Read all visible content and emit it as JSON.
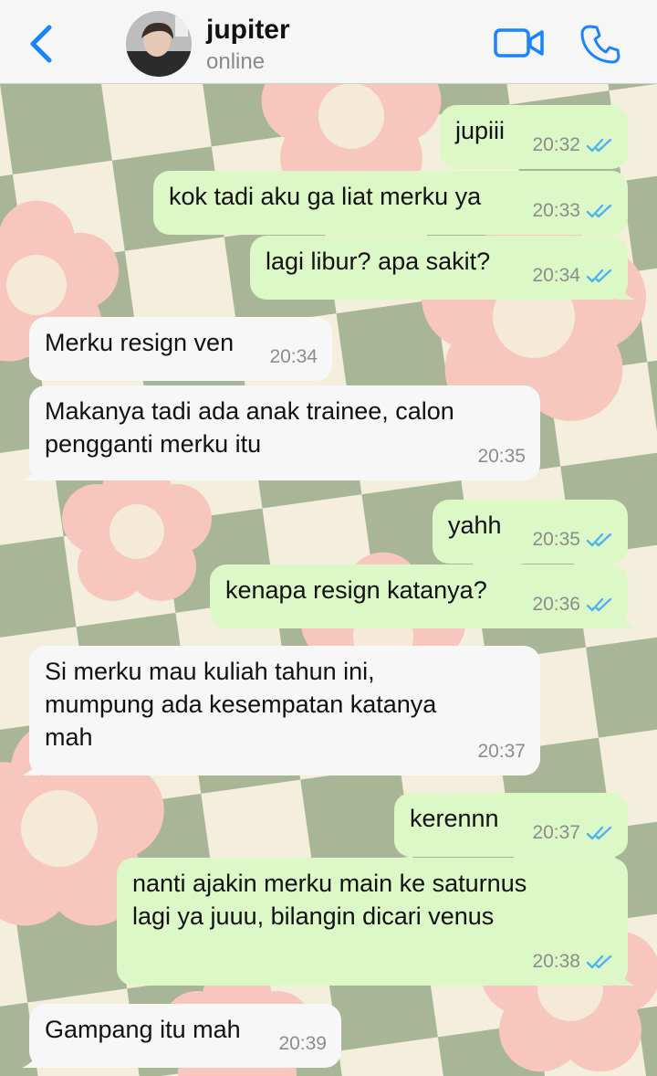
{
  "contact": {
    "name": "jupiter",
    "status": "online"
  },
  "icons": {
    "back": "chevron-left-icon",
    "video": "video-camera-icon",
    "call": "phone-icon",
    "read": "double-check-icon"
  },
  "colors": {
    "accent": "#1a84ff",
    "outgoing_bubble": "#dcf8c6",
    "incoming_bubble": "#f7f7f7",
    "read_ticks": "#4fb2ef"
  },
  "messages": [
    {
      "direction": "out",
      "text": "jupiii",
      "time": "20:32",
      "read": true
    },
    {
      "direction": "out",
      "text": "kok tadi aku ga liat merku ya",
      "time": "20:33",
      "read": true
    },
    {
      "direction": "out",
      "text": "lagi libur? apa sakit?",
      "time": "20:34",
      "read": true
    },
    {
      "direction": "in",
      "text": "Merku resign ven",
      "time": "20:34"
    },
    {
      "direction": "in",
      "text": "Makanya tadi ada anak trainee, calon\npengganti merku itu",
      "time": "20:35"
    },
    {
      "direction": "out",
      "text": "yahh",
      "time": "20:35",
      "read": true
    },
    {
      "direction": "out",
      "text": "kenapa resign katanya?",
      "time": "20:36",
      "read": true
    },
    {
      "direction": "in",
      "text": "Si merku mau kuliah tahun ini,\nmumpung ada kesempatan katanya\nmah",
      "time": "20:37"
    },
    {
      "direction": "out",
      "text": "kerennn",
      "time": "20:37",
      "read": true
    },
    {
      "direction": "out",
      "text": "nanti ajakin merku main ke saturnus\nlagi ya juuu, bilangin dicari venus",
      "time": "20:38",
      "read": true
    },
    {
      "direction": "in",
      "text": "Gampang itu mah",
      "time": "20:39"
    }
  ]
}
